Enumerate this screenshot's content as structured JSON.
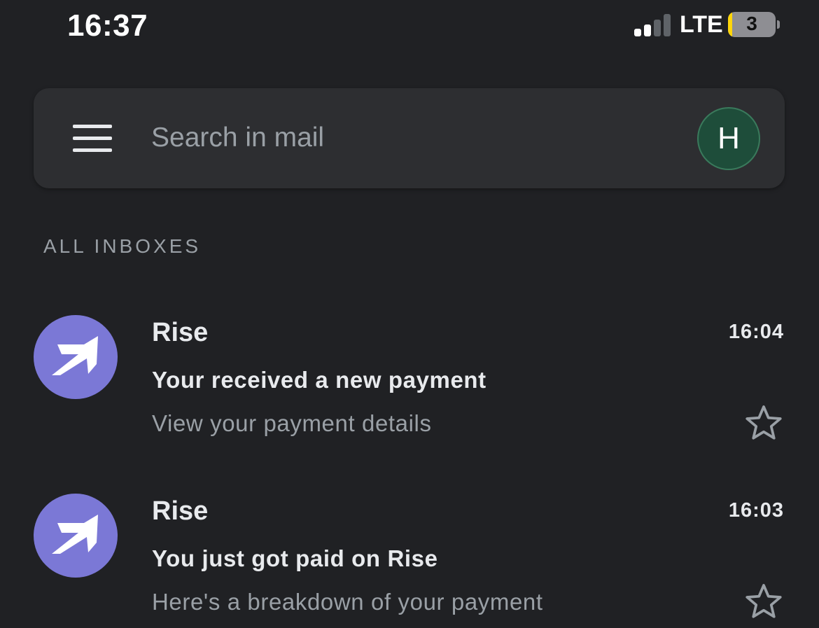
{
  "status_bar": {
    "time": "16:37",
    "network": "LTE",
    "battery_level": "3",
    "icons": [
      "signal-icon",
      "battery-icon"
    ],
    "signal_bars_active": 2,
    "signal_bars_total": 4
  },
  "search": {
    "placeholder": "Search in mail",
    "value": "",
    "menu_icon": "menu-icon",
    "avatar_initial": "H"
  },
  "inbox": {
    "section_label": "ALL INBOXES",
    "emails": [
      {
        "sender": "Rise",
        "time": "16:04",
        "subject": "Your received a new payment",
        "snippet": "View your payment details",
        "starred": false
      },
      {
        "sender": "Rise",
        "time": "16:03",
        "subject": "You just got paid on Rise",
        "snippet": "Here's a breakdown of your payment",
        "starred": false
      }
    ]
  },
  "colors": {
    "background": "#202124",
    "search_bar": "#2d2e31",
    "sender_avatar": "#7b78d6",
    "account_avatar": "#1e4d3a",
    "secondary_text": "#9aa0a6",
    "battery_low": "#ffd60a"
  }
}
